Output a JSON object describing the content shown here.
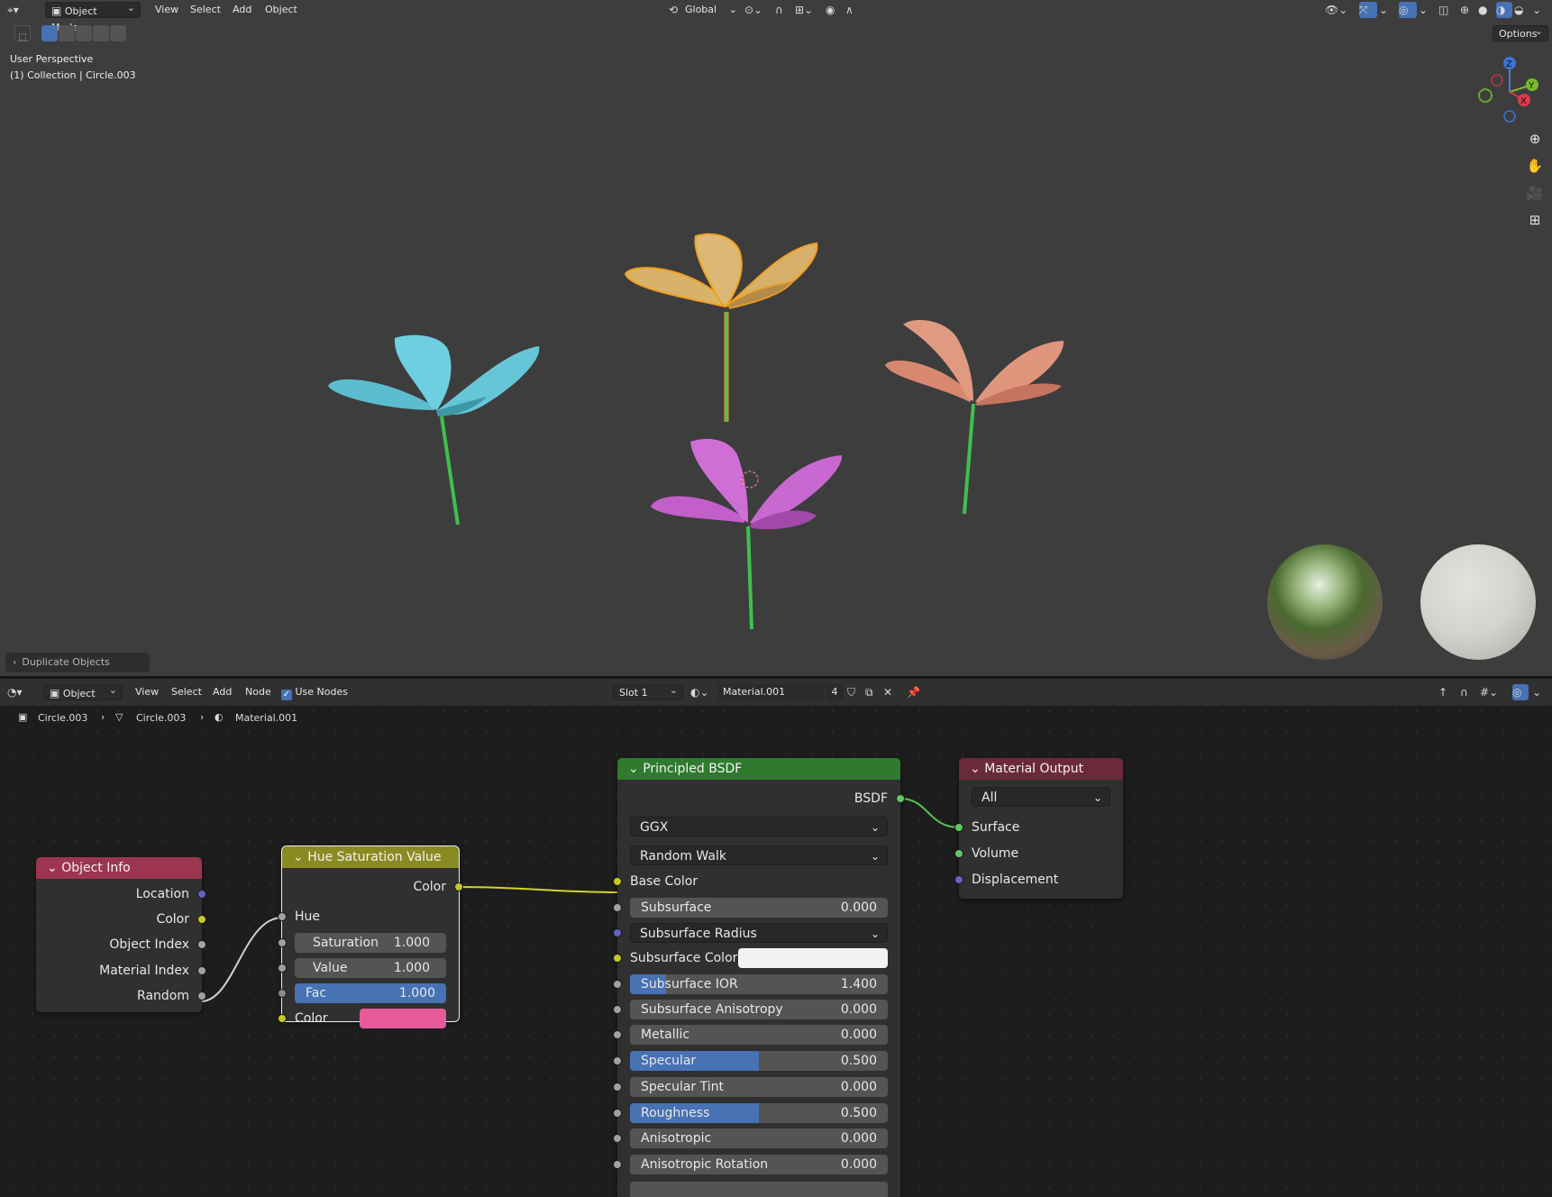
{
  "viewport_header": {
    "mode": "Object Mode",
    "menus": [
      "View",
      "Select",
      "Add",
      "Object"
    ],
    "orientation": "Global",
    "options": "Options"
  },
  "viewport_overlay": {
    "perspective": "User Perspective",
    "collection": "(1) Collection | Circle.003",
    "last_operator": "Duplicate Objects"
  },
  "gizmo": {
    "z": "Z",
    "y": "Y",
    "x": "X"
  },
  "flowers": [
    {
      "name": "cyan-flower",
      "petal_color": "#5fbfcf",
      "stem_color": "#3fbf4f"
    },
    {
      "name": "yellow-flower",
      "petal_color": "#d9b26a",
      "stem_color": "#58b84a",
      "selected": true
    },
    {
      "name": "salmon-flower",
      "petal_color": "#d98a70",
      "stem_color": "#3fbf4f"
    },
    {
      "name": "magenta-flower",
      "petal_color": "#c466cc",
      "stem_color": "#3fbf4f"
    }
  ],
  "node_header": {
    "type": "Object",
    "menus": [
      "View",
      "Select",
      "Add",
      "Node"
    ],
    "use_nodes": "Use Nodes",
    "slot": "Slot 1",
    "material": "Material.001",
    "users": "4"
  },
  "breadcrumb": {
    "object": "Circle.003",
    "mesh": "Circle.003",
    "material": "Material.001"
  },
  "nodes": {
    "object_info": {
      "title": "Object Info",
      "outputs": [
        "Location",
        "Color",
        "Object Index",
        "Material Index",
        "Random"
      ]
    },
    "hsv": {
      "title": "Hue Saturation Value",
      "out_color": "Color",
      "hue": "Hue",
      "saturation_label": "Saturation",
      "saturation": "1.000",
      "value_label": "Value",
      "value": "1.000",
      "fac_label": "Fac",
      "fac": "1.000",
      "color_label": "Color",
      "color_swatch": "#e85a9a"
    },
    "bsdf": {
      "title": "Principled BSDF",
      "output": "BSDF",
      "distribution": "GGX",
      "subsurface_method": "Random Walk",
      "base_color": "Base Color",
      "subsurface_radius": "Subsurface Radius",
      "subsurface_color": "Subsurface Color",
      "fields": [
        {
          "label": "Subsurface",
          "value": "0.000",
          "fill": 0.0
        },
        {
          "label": "Subsurface IOR",
          "value": "1.400",
          "fill": 0.14
        },
        {
          "label": "Subsurface Anisotropy",
          "value": "0.000",
          "fill": 0.0
        },
        {
          "label": "Metallic",
          "value": "0.000",
          "fill": 0.0
        },
        {
          "label": "Specular",
          "value": "0.500",
          "fill": 0.5
        },
        {
          "label": "Specular Tint",
          "value": "0.000",
          "fill": 0.0
        },
        {
          "label": "Roughness",
          "value": "0.500",
          "fill": 0.5
        },
        {
          "label": "Anisotropic",
          "value": "0.000",
          "fill": 0.0
        },
        {
          "label": "Anisotropic Rotation",
          "value": "0.000",
          "fill": 0.0
        }
      ]
    },
    "output": {
      "title": "Material Output",
      "target": "All",
      "inputs": [
        "Surface",
        "Volume",
        "Displacement"
      ]
    }
  },
  "colors": {
    "object_info_header": "#9c3650",
    "hsv_header": "#8a8a22",
    "bsdf_header": "#2f7a2f",
    "output_header": "#6b2a3a",
    "accent": "#4772b3"
  }
}
